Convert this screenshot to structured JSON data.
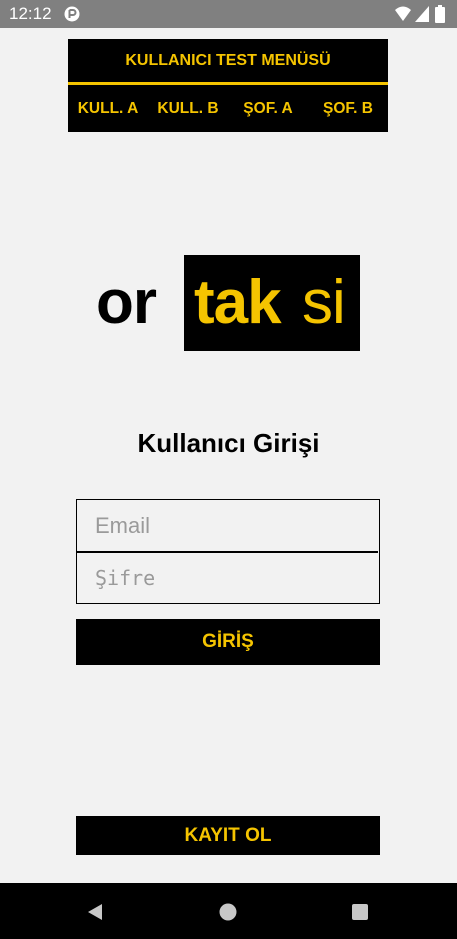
{
  "status_bar": {
    "time": "12:12",
    "icons": [
      "app-notification-icon",
      "wifi-icon",
      "cellular-signal-icon",
      "battery-icon"
    ]
  },
  "test_menu": {
    "title": "KULLANICI TEST MENÜSÜ",
    "buttons": [
      "KULL. A",
      "KULL. B",
      "ŞOF. A",
      "ŞOF. B"
    ]
  },
  "logo": {
    "part_or": "or",
    "part_tak": "tak",
    "part_si": "si"
  },
  "login": {
    "title": "Kullanıcı Girişi",
    "email_placeholder": "Email",
    "email_value": "",
    "password_placeholder": "Şifre",
    "password_value": "",
    "submit_label": "GİRİŞ",
    "register_label": "KAYIT OL"
  },
  "nav_bar": {
    "icons": [
      "back-icon",
      "home-icon",
      "recents-icon"
    ]
  },
  "colors": {
    "accent_yellow": "#f5c400",
    "black": "#000000",
    "background": "#f2f2f2",
    "status_bar": "#808080"
  }
}
